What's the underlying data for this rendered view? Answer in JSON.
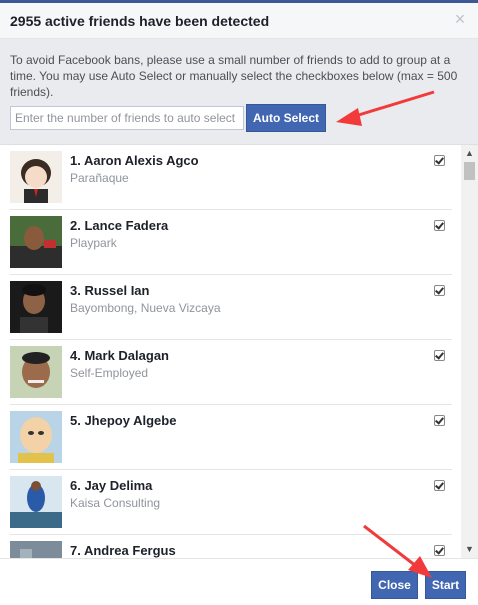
{
  "dialog": {
    "title": "2955 active friends have been detected",
    "close_glyph": "×"
  },
  "info": {
    "message": "To avoid Facebook bans, please use a small number of friends to add to group at a time. You may use Auto Select or manually select the checkboxes below (max = 500 friends).",
    "input_placeholder": "Enter the number of friends to auto select",
    "input_value": "",
    "auto_select_label": "Auto Select"
  },
  "friends": [
    {
      "name": "1. Aaron Alexis Agco",
      "detail": "Parañaque",
      "checked": true
    },
    {
      "name": "2. Lance Fadera",
      "detail": "Playpark",
      "checked": true
    },
    {
      "name": "3. Russel Ian",
      "detail": "Bayombong, Nueva Vizcaya",
      "checked": true
    },
    {
      "name": "4. Mark Dalagan",
      "detail": "Self-Employed",
      "checked": true
    },
    {
      "name": "5. Jhepoy Algebe",
      "detail": "",
      "checked": true
    },
    {
      "name": "6. Jay Delima",
      "detail": "Kaisa Consulting",
      "checked": true
    },
    {
      "name": "7. Andrea Fergus",
      "detail": "",
      "checked": true
    }
  ],
  "footer": {
    "close_label": "Close",
    "start_label": "Start"
  },
  "colors": {
    "accent": "#4267b2",
    "annotation_arrow": "#f23a3a"
  }
}
